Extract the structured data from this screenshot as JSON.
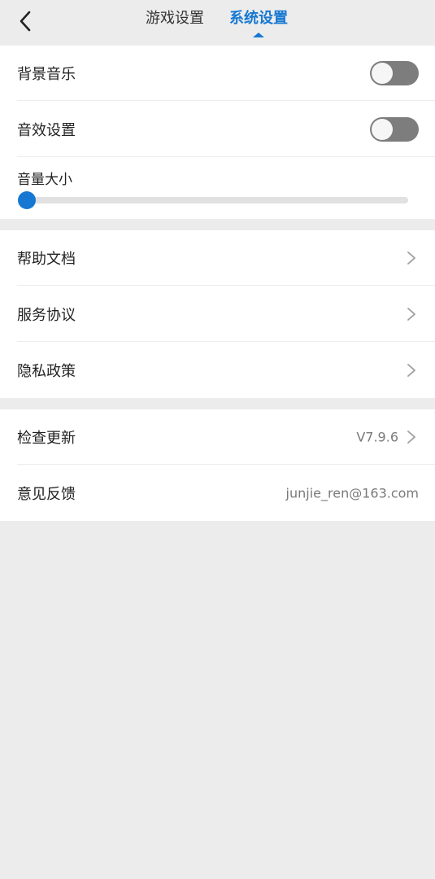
{
  "header": {
    "tabs": [
      {
        "label": "游戏设置",
        "active": false
      },
      {
        "label": "系统设置",
        "active": true
      }
    ],
    "accent_color": "#1678d2"
  },
  "sound": {
    "bgm_label": "背景音乐",
    "bgm_on": false,
    "sfx_label": "音效设置",
    "sfx_on": false,
    "volume_label": "音量大小",
    "volume_level": 0
  },
  "links": {
    "help_label": "帮助文档",
    "terms_label": "服务协议",
    "privacy_label": "隐私政策"
  },
  "about": {
    "update_label": "检查更新",
    "version": "V7.9.6",
    "feedback_label": "意见反馈",
    "feedback_email": "junjie_ren@163.com"
  }
}
